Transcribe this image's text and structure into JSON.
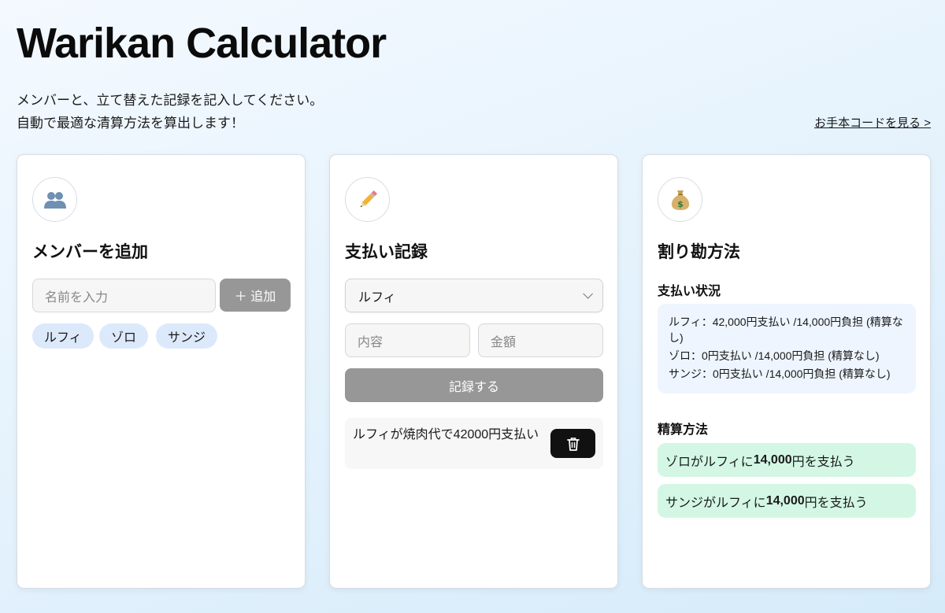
{
  "header": {
    "title": "Warikan Calculator",
    "subtitle_line1": "メンバーと、立て替えた記録を記入してください。",
    "subtitle_line2": "自動で最適な清算方法を算出します！",
    "sample_link": "お手本コードを見る >"
  },
  "members": {
    "icon": "people-icon",
    "title": "メンバーを追加",
    "name_placeholder": "名前を入力",
    "add_label": "＋ 追加",
    "chips": [
      "ルフィ",
      "ゾロ",
      "サンジ"
    ]
  },
  "payments": {
    "icon": "pencil-icon",
    "title": "支払い記録",
    "payer_selected": "ルフィ",
    "content_placeholder": "内容",
    "amount_placeholder": "金額",
    "record_label": "記録する",
    "records": [
      {
        "text": "ルフィが焼肉代で42000円支払い"
      }
    ]
  },
  "split": {
    "icon": "money-bag-icon",
    "title": "割り勘方法",
    "status_label": "支払い状況",
    "status_lines": [
      "ルフィ：42,000円支払い /14,000円負担 (精算なし)",
      "ゾロ：0円支払い /14,000円負担 (精算なし)",
      "サンジ：0円支払い /14,000円負担 (精算なし)"
    ],
    "method_label": "精算方法",
    "settlements": [
      {
        "from": "ゾロがルフィに",
        "amount": "14,000",
        "suffix": "円を支払う"
      },
      {
        "from": "サンジがルフィに",
        "amount": "14,000",
        "suffix": "円を支払う"
      }
    ]
  }
}
